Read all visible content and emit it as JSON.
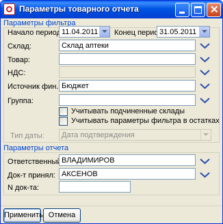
{
  "window": {
    "title": "Параметры товарного отчета"
  },
  "filter_section": {
    "title": "Параметры фильтра",
    "period_start": {
      "label": "Начало периода:",
      "value": "11.04.2011"
    },
    "period_end": {
      "label": "Конец периода:",
      "value": "31.05.2011"
    },
    "warehouse": {
      "label": "Склад:",
      "value": "Склад аптеки"
    },
    "product": {
      "label": "Товар:",
      "value": ""
    },
    "vat": {
      "label": "НДС:",
      "value": ""
    },
    "finance_source": {
      "label": "Источник фин.:",
      "value": "Бюджет"
    },
    "group": {
      "label": "Группа:",
      "value": ""
    },
    "include_sub_warehouses": {
      "label": "Учитывать подчиненные склады",
      "checked": false
    },
    "use_filter_in_balances": {
      "label": "Учитывать параметры фильтра в остатках",
      "checked": false
    },
    "date_type": {
      "label": "Тип даты:",
      "value": "Дата подтверждения",
      "disabled": true
    }
  },
  "report_section": {
    "title": "Параметры отчета",
    "responsible": {
      "label": "Ответственный:",
      "value": "ВЛАДИМИРОВ"
    },
    "doc_received": {
      "label": "Док-т принял:",
      "value": "АКСЕНОВ"
    },
    "doc_number": {
      "label": "N док-та:",
      "value": ""
    }
  },
  "buttons": {
    "apply": "Применить",
    "cancel": "Отмена"
  },
  "colors": {
    "titlebar": "#0055e5",
    "section_title": "#0046d5",
    "chevron": "#2b4fb0",
    "window_bg": "#ece9d8"
  }
}
